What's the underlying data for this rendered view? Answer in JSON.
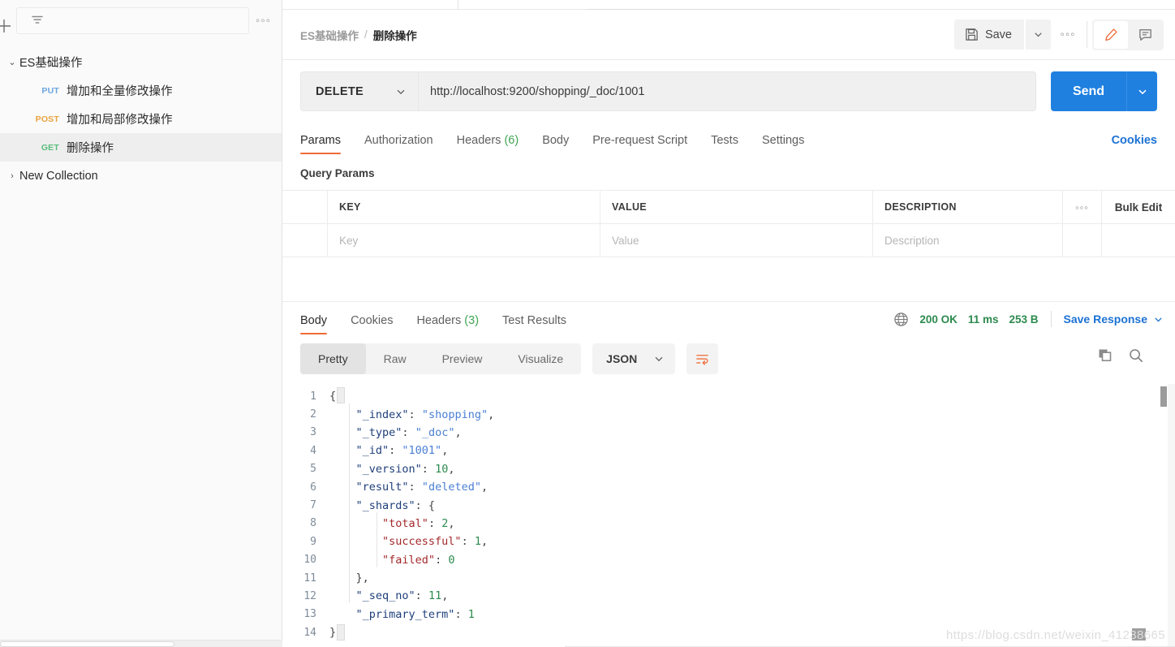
{
  "sidebar": {
    "add_label": "+",
    "filter_placeholder": "",
    "more_label": "◦◦◦",
    "collections": [
      {
        "name": "ES基础操作",
        "expanded": true,
        "caret": "⌄",
        "requests": [
          {
            "method": "PUT",
            "name": "增加和全量修改操作",
            "selected": false
          },
          {
            "method": "POST",
            "name": "增加和局部修改操作",
            "selected": false
          },
          {
            "method": "GET",
            "name": "删除操作",
            "selected": true
          }
        ]
      },
      {
        "name": "New Collection",
        "expanded": false,
        "caret": "›",
        "requests": []
      }
    ]
  },
  "header": {
    "breadcrumb_collection": "ES基础操作",
    "breadcrumb_sep": "/",
    "breadcrumb_request": "删除操作",
    "save_label": "Save",
    "save_caret": "⌄",
    "more_label": "◦◦◦"
  },
  "request": {
    "method": "DELETE",
    "method_caret": "⌄",
    "url": "http://localhost:9200/shopping/_doc/1001",
    "send_label": "Send",
    "send_caret": "⌄",
    "tabs": [
      {
        "label": "Params",
        "count": "",
        "active": true
      },
      {
        "label": "Authorization",
        "count": "",
        "active": false
      },
      {
        "label": "Headers",
        "count": "(6)",
        "active": false
      },
      {
        "label": "Body",
        "count": "",
        "active": false
      },
      {
        "label": "Pre-request Script",
        "count": "",
        "active": false
      },
      {
        "label": "Tests",
        "count": "",
        "active": false
      },
      {
        "label": "Settings",
        "count": "",
        "active": false
      }
    ],
    "cookies_link": "Cookies",
    "query_params_title": "Query Params",
    "params_table": {
      "columns": [
        "KEY",
        "VALUE",
        "DESCRIPTION"
      ],
      "more_label": "◦◦◦",
      "bulk_edit_label": "Bulk Edit",
      "placeholders": {
        "key": "Key",
        "value": "Value",
        "description": "Description"
      },
      "rows": []
    }
  },
  "response": {
    "tabs": [
      {
        "label": "Body",
        "count": "",
        "active": true
      },
      {
        "label": "Cookies",
        "count": "",
        "active": false
      },
      {
        "label": "Headers",
        "count": "(3)",
        "active": false
      },
      {
        "label": "Test Results",
        "count": "",
        "active": false
      }
    ],
    "status": "200 OK",
    "time": "11 ms",
    "size": "253 B",
    "save_response_label": "Save Response",
    "save_response_caret": "⌄",
    "view_modes": [
      {
        "label": "Pretty",
        "active": true
      },
      {
        "label": "Raw",
        "active": false
      },
      {
        "label": "Preview",
        "active": false
      },
      {
        "label": "Visualize",
        "active": false
      }
    ],
    "format": "JSON",
    "format_caret": "⌄",
    "body_lines": [
      {
        "n": "1",
        "indent": 0,
        "tokens": [
          {
            "t": "pun",
            "v": "{"
          }
        ]
      },
      {
        "n": "2",
        "indent": 1,
        "tokens": [
          {
            "t": "key",
            "v": "\"_index\""
          },
          {
            "t": "pun",
            "v": ": "
          },
          {
            "t": "str",
            "v": "\"shopping\""
          },
          {
            "t": "pun",
            "v": ","
          }
        ]
      },
      {
        "n": "3",
        "indent": 1,
        "tokens": [
          {
            "t": "key",
            "v": "\"_type\""
          },
          {
            "t": "pun",
            "v": ": "
          },
          {
            "t": "str",
            "v": "\"_doc\""
          },
          {
            "t": "pun",
            "v": ","
          }
        ]
      },
      {
        "n": "4",
        "indent": 1,
        "tokens": [
          {
            "t": "key",
            "v": "\"_id\""
          },
          {
            "t": "pun",
            "v": ": "
          },
          {
            "t": "str",
            "v": "\"1001\""
          },
          {
            "t": "pun",
            "v": ","
          }
        ]
      },
      {
        "n": "5",
        "indent": 1,
        "tokens": [
          {
            "t": "key",
            "v": "\"_version\""
          },
          {
            "t": "pun",
            "v": ": "
          },
          {
            "t": "num",
            "v": "10"
          },
          {
            "t": "pun",
            "v": ","
          }
        ]
      },
      {
        "n": "6",
        "indent": 1,
        "tokens": [
          {
            "t": "key",
            "v": "\"result\""
          },
          {
            "t": "pun",
            "v": ": "
          },
          {
            "t": "str",
            "v": "\"deleted\""
          },
          {
            "t": "pun",
            "v": ","
          }
        ]
      },
      {
        "n": "7",
        "indent": 1,
        "tokens": [
          {
            "t": "key",
            "v": "\"_shards\""
          },
          {
            "t": "pun",
            "v": ": {"
          }
        ]
      },
      {
        "n": "8",
        "indent": 2,
        "tokens": [
          {
            "t": "key2",
            "v": "\"total\""
          },
          {
            "t": "pun",
            "v": ": "
          },
          {
            "t": "num",
            "v": "2"
          },
          {
            "t": "pun",
            "v": ","
          }
        ]
      },
      {
        "n": "9",
        "indent": 2,
        "tokens": [
          {
            "t": "key2",
            "v": "\"successful\""
          },
          {
            "t": "pun",
            "v": ": "
          },
          {
            "t": "num",
            "v": "1"
          },
          {
            "t": "pun",
            "v": ","
          }
        ]
      },
      {
        "n": "10",
        "indent": 2,
        "tokens": [
          {
            "t": "key2",
            "v": "\"failed\""
          },
          {
            "t": "pun",
            "v": ": "
          },
          {
            "t": "num",
            "v": "0"
          }
        ]
      },
      {
        "n": "11",
        "indent": 1,
        "tokens": [
          {
            "t": "pun",
            "v": "},"
          }
        ]
      },
      {
        "n": "12",
        "indent": 1,
        "tokens": [
          {
            "t": "key",
            "v": "\"_seq_no\""
          },
          {
            "t": "pun",
            "v": ": "
          },
          {
            "t": "num",
            "v": "11"
          },
          {
            "t": "pun",
            "v": ","
          }
        ]
      },
      {
        "n": "13",
        "indent": 1,
        "tokens": [
          {
            "t": "key",
            "v": "\"_primary_term\""
          },
          {
            "t": "pun",
            "v": ": "
          },
          {
            "t": "num",
            "v": "1"
          }
        ]
      },
      {
        "n": "14",
        "indent": 0,
        "tokens": [
          {
            "t": "pun",
            "v": "}"
          }
        ]
      }
    ]
  },
  "watermark": "https://blog.csdn.net/weixin_41238665",
  "colors": {
    "accent_orange": "#ef6c37",
    "link_blue": "#1d72d4",
    "send_blue": "#1f80e0",
    "status_green": "#2c8a4e",
    "verb_put": "#6ca4e0",
    "verb_post": "#e8a33d",
    "verb_get": "#59bd7c"
  }
}
